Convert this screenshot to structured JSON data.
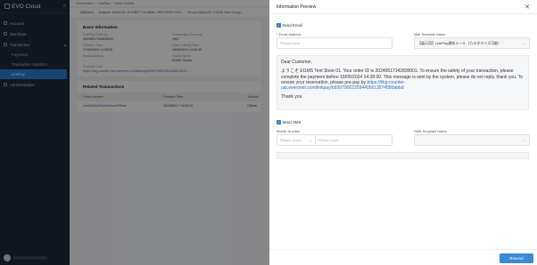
{
  "sidebar": {
    "logo": "EVO Cloud",
    "collapse_icon": "chevrons-left-icon",
    "items": [
      {
        "label": "Account"
      },
      {
        "label": "Merchant"
      },
      {
        "label": "Transaction"
      },
      {
        "label": "Payments"
      },
      {
        "label": "Transaction Statistics"
      },
      {
        "label": "LinkPay"
      },
      {
        "label": "Administration"
      }
    ]
  },
  "main": {
    "breadcrumb": [
      "Transaction",
      "LinkPay",
      "Order Details"
    ],
    "affiliation_label": "Affiliation:",
    "affiliation_value": "Acquirer Name/ID: EVOBET GLOBAL SRVCHRG EVO...",
    "group_value": "Group Name/ID: EGMS Test Group...",
    "basic_title": "Basic Information",
    "fields": [
      {
        "k": "LinkPay Order ID",
        "v": "20240517142830001"
      },
      {
        "k": "Transaction Currency",
        "v": "HKD"
      },
      {
        "k": "Creation Time",
        "v": "17/05/2024 14:28:30"
      },
      {
        "k": "Order Validity Time",
        "v": "18/05/2024 14:28:30"
      },
      {
        "k": "Email Address",
        "v": "-"
      },
      {
        "k": "Goods Name",
        "v": "EGMS Goods"
      }
    ],
    "payment_link_label": "Payment Link",
    "payment_link": "https://hkg-counter-uat.everonet.com/linkpay/b930790622594405613574...",
    "related_title": "Related Transactions",
    "table_headers": [
      "Order Number",
      "Creation Time",
      "Transac"
    ],
    "table_rows": [
      [
        "1a4500d4495a4d90ecb299aef",
        "2024/05/17 14:29:22",
        "Others"
      ]
    ]
  },
  "drawer": {
    "title": "Information Preview",
    "close_icon": "close-icon",
    "send_email_label": "Send Email",
    "email_label": "Email Address",
    "email_placeholder": "Please input",
    "mail_template_label": "Mail Template Name",
    "mail_template_value": "【展示用】LinkPay通知メール（カスタマイズ可能）",
    "message": {
      "greeting": "Dear Customer,",
      "body": "ようこそ EGMS Test Store 01. Your order ID is 20240517142830001. To ensure the safety of your transaction, please complete the payment before 18/05/2024 14:28:30. This message is sent by the system, please do not reply, thank you. To ensure your reservation, please pre-pay by",
      "link": "https://hkg-counter-uat.everonet.com/linkpay/b930790622594405613574580abbd",
      "thanks": "Thank you"
    },
    "send_sms_label": "Send SMS",
    "mobile_label": "Mobile Number",
    "mobile_code_placeholder": "Please select",
    "mobile_placeholder": "Please input",
    "sms_template_label": "SMS Template Name",
    "resend_label": "Resend"
  }
}
